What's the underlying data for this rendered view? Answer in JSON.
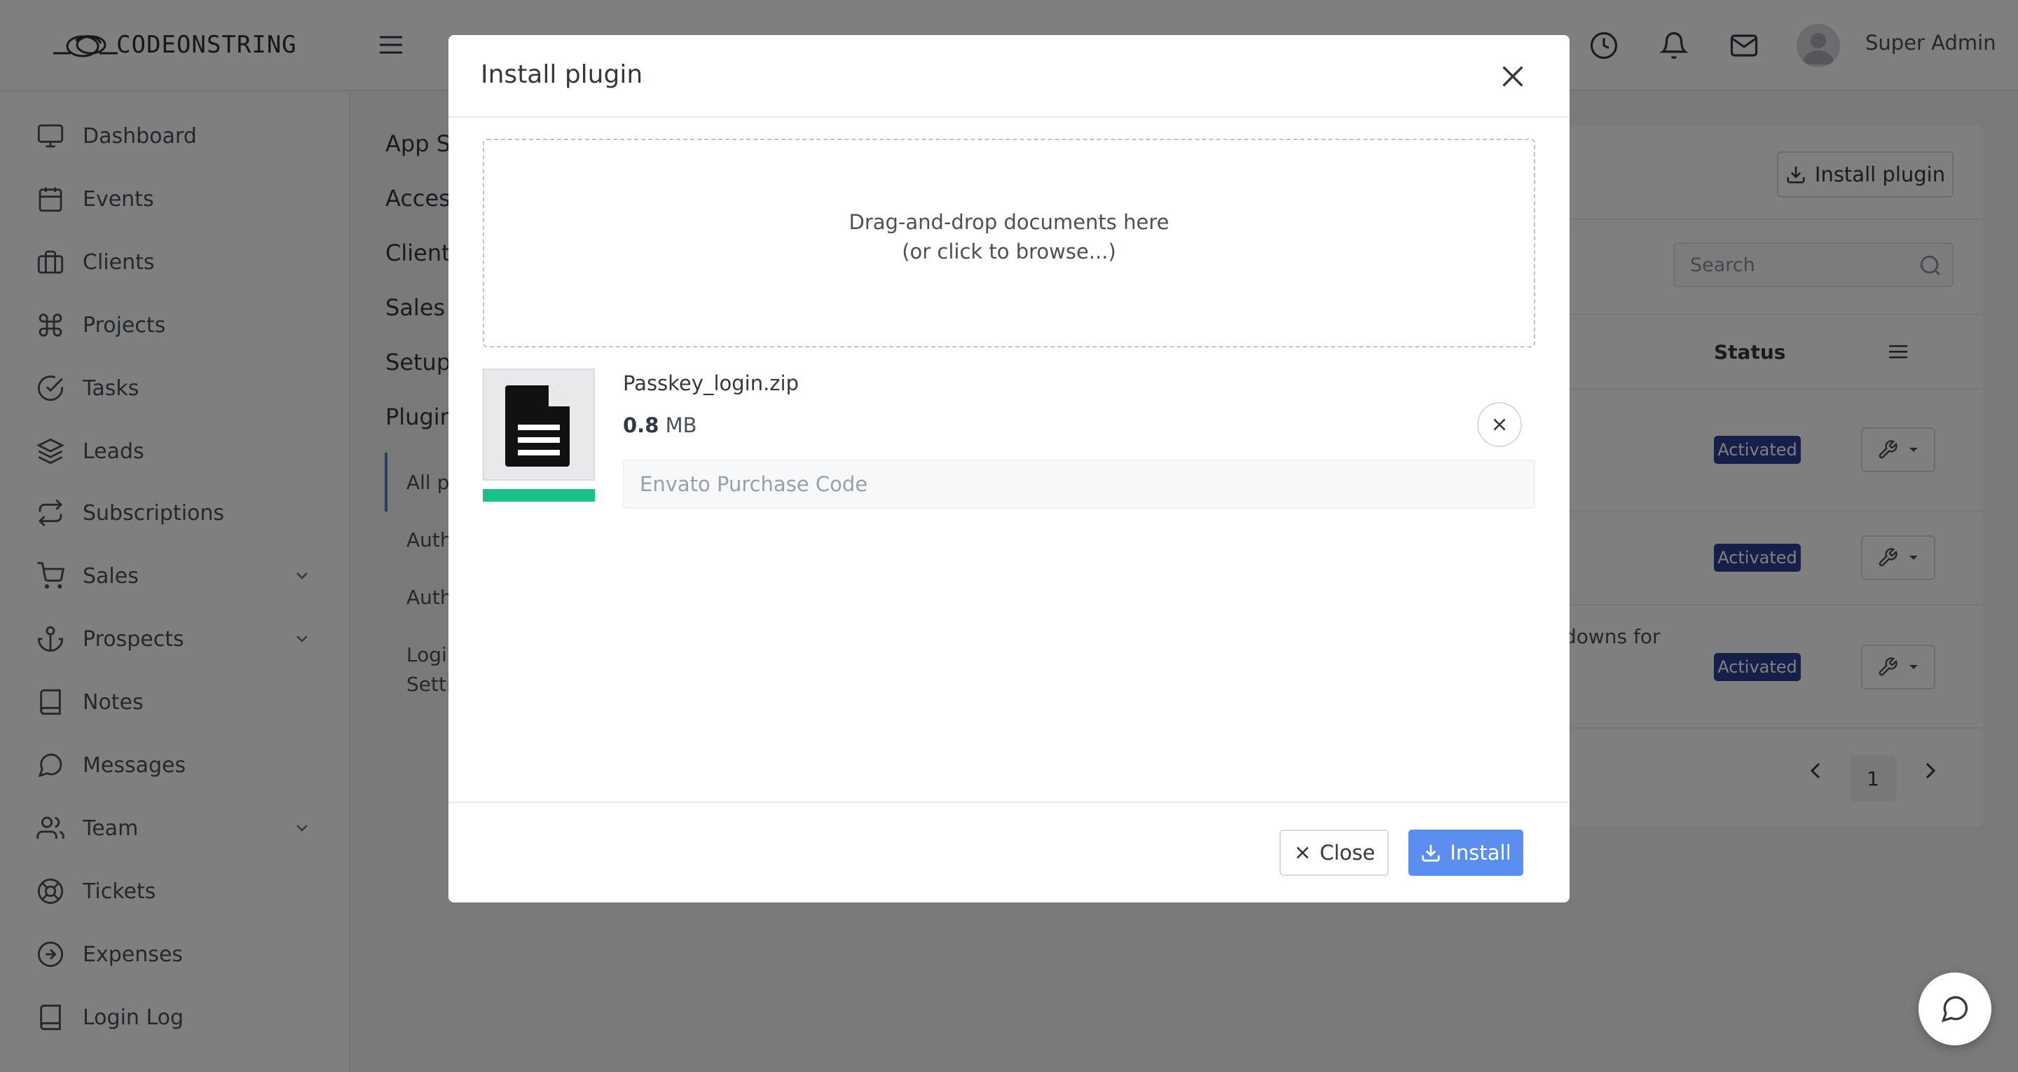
{
  "app": {
    "brand": "CODEONSTRING"
  },
  "header": {
    "user_name": "Super Admin"
  },
  "sidebar": {
    "items": [
      {
        "label": "Dashboard",
        "icon": "monitor-icon"
      },
      {
        "label": "Events",
        "icon": "calendar-icon"
      },
      {
        "label": "Clients",
        "icon": "briefcase-icon"
      },
      {
        "label": "Projects",
        "icon": "command-icon"
      },
      {
        "label": "Tasks",
        "icon": "check-circle-icon"
      },
      {
        "label": "Leads",
        "icon": "layers-icon"
      },
      {
        "label": "Subscriptions",
        "icon": "repeat-icon"
      },
      {
        "label": "Sales",
        "icon": "cart-icon",
        "expandable": true
      },
      {
        "label": "Prospects",
        "icon": "anchor-icon",
        "expandable": true
      },
      {
        "label": "Notes",
        "icon": "book-icon"
      },
      {
        "label": "Messages",
        "icon": "message-circle-icon"
      },
      {
        "label": "Team",
        "icon": "users-icon",
        "expandable": true
      },
      {
        "label": "Tickets",
        "icon": "life-buoy-icon"
      },
      {
        "label": "Expenses",
        "icon": "arrow-right-circle-icon"
      },
      {
        "label": "Login Log",
        "icon": "book-icon"
      }
    ]
  },
  "settings_nav": {
    "items": [
      "App Se",
      "Access",
      "Client",
      "Sales a",
      "Setup",
      "Plugin"
    ],
    "sub_items": [
      "All p",
      "Auth",
      "Auth",
      "Login",
      "Setti"
    ]
  },
  "main": {
    "install_plugin_label": "Install plugin",
    "search_placeholder": "Search",
    "status_header": "Status",
    "rows": [
      {
        "status": "Activated"
      },
      {
        "status": "Activated"
      },
      {
        "status": "Activated",
        "desc_fragment": "downs for"
      }
    ],
    "page_number": "1"
  },
  "modal": {
    "title": "Install plugin",
    "dropzone_line1": "Drag-and-drop documents here",
    "dropzone_line2": "(or click to browse...)",
    "file": {
      "name": "Passkey_login.zip",
      "size_value": "0.8",
      "size_unit": "MB",
      "upload_progress": 1.0
    },
    "purchase_code_placeholder": "Envato Purchase Code",
    "close_label": "Close",
    "install_label": "Install"
  },
  "colors": {
    "primary": "#5b8ef0",
    "badge": "#2c3e94",
    "progress": "#1bc08a"
  }
}
